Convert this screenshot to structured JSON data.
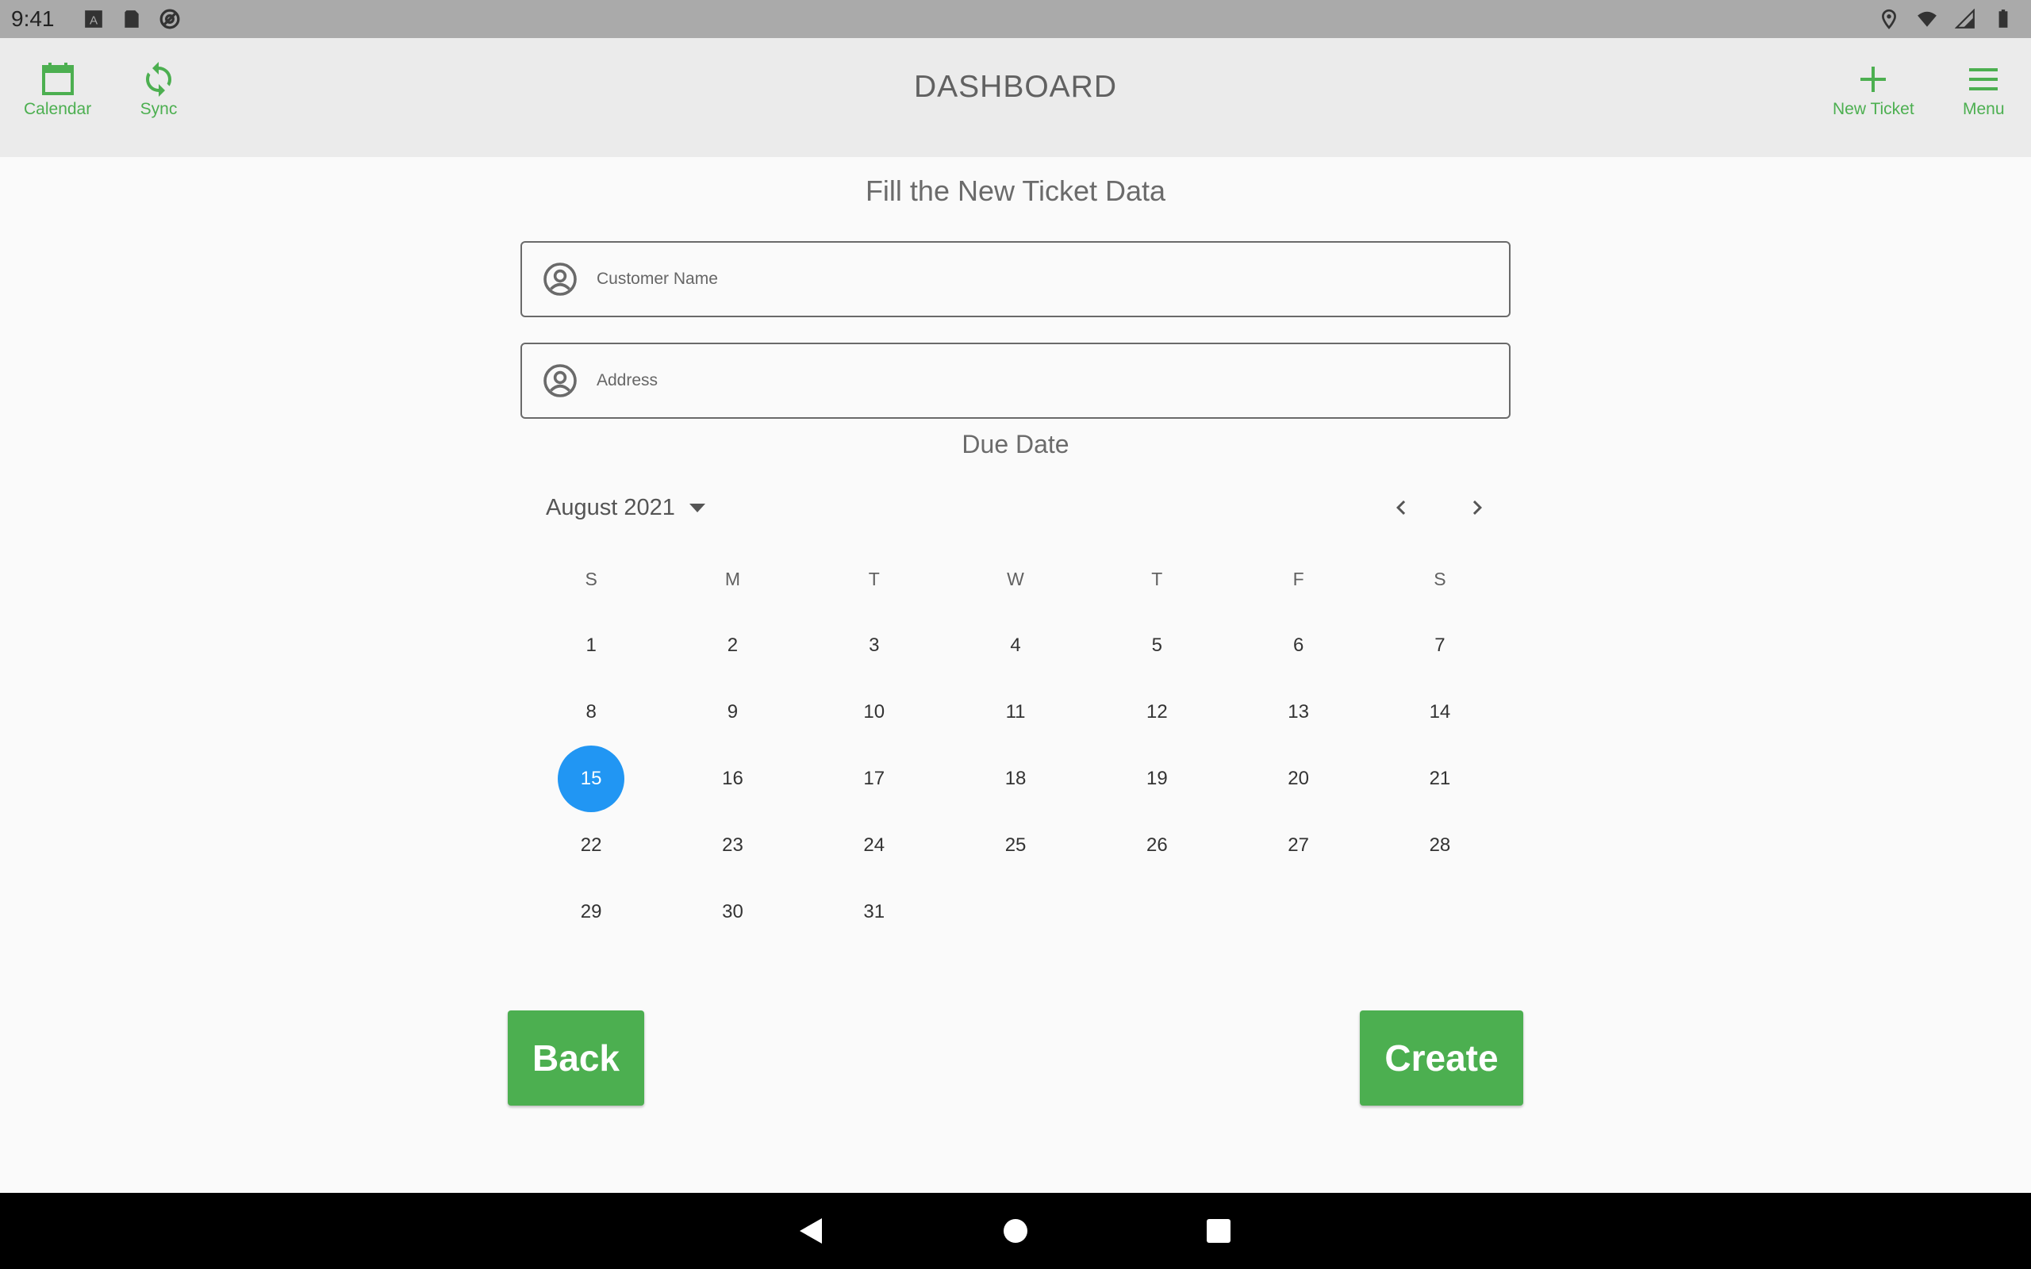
{
  "status_bar": {
    "time": "9:41",
    "left_icons": [
      "font-icon",
      "sd-card-icon",
      "at-circle-icon"
    ],
    "right_icons": [
      "location-icon",
      "wifi-icon",
      "signal-icon",
      "battery-icon"
    ]
  },
  "app_bar": {
    "title": "DASHBOARD",
    "calendar_label": "Calendar",
    "sync_label": "Sync",
    "new_ticket_label": "New Ticket",
    "menu_label": "Menu",
    "accent_color": "#4caf50"
  },
  "form": {
    "heading": "Fill the New Ticket Data",
    "customer_name": {
      "value": "",
      "placeholder": "Customer Name"
    },
    "address": {
      "value": "",
      "placeholder": "Address"
    },
    "due_date_label": "Due Date"
  },
  "calendar": {
    "month_label": "August 2021",
    "weekdays": [
      "S",
      "M",
      "T",
      "W",
      "T",
      "F",
      "S"
    ],
    "weeks": [
      [
        "1",
        "2",
        "3",
        "4",
        "5",
        "6",
        "7"
      ],
      [
        "8",
        "9",
        "10",
        "11",
        "12",
        "13",
        "14"
      ],
      [
        "15",
        "16",
        "17",
        "18",
        "19",
        "20",
        "21"
      ],
      [
        "22",
        "23",
        "24",
        "25",
        "26",
        "27",
        "28"
      ],
      [
        "29",
        "30",
        "31",
        "",
        "",
        "",
        ""
      ]
    ],
    "selected_day": "15",
    "selected_color": "#2196f3"
  },
  "actions": {
    "back_label": "Back",
    "create_label": "Create"
  },
  "nav_bar": {
    "icons": [
      "back-triangle-icon",
      "home-circle-icon",
      "recents-square-icon"
    ]
  }
}
